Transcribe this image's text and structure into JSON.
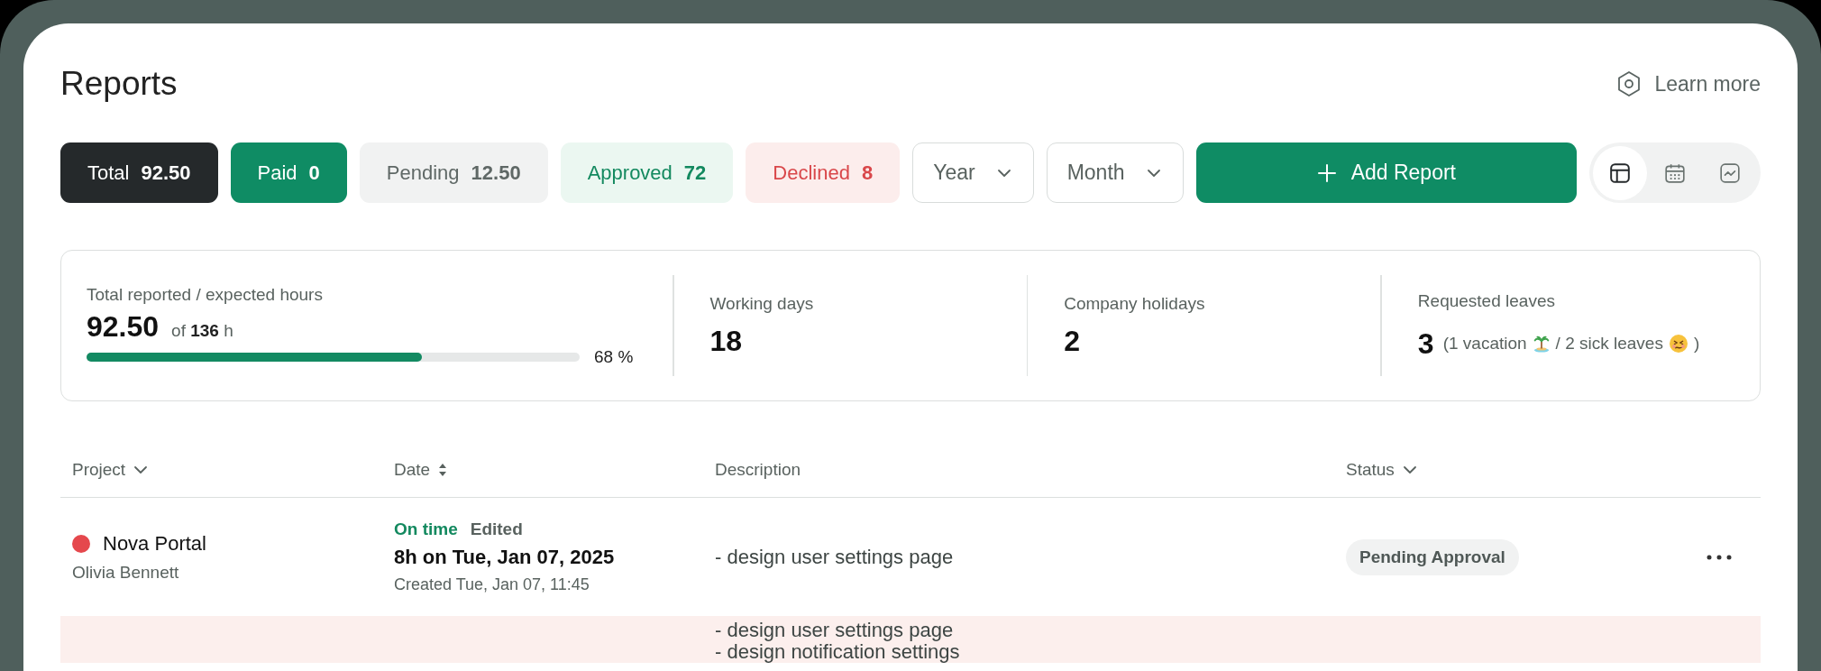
{
  "page_title": "Reports",
  "learn_more": "Learn more",
  "filters": [
    {
      "kind": "dark",
      "label": "Total",
      "count": "92.50"
    },
    {
      "kind": "green",
      "label": "Paid",
      "count": "0"
    },
    {
      "kind": "grey",
      "label": "Pending",
      "count": "12.50"
    },
    {
      "kind": "mint",
      "label": "Approved",
      "count": "72"
    },
    {
      "kind": "red",
      "label": "Declined",
      "count": "8"
    }
  ],
  "dropdowns": [
    {
      "label": "Year"
    },
    {
      "label": "Month"
    }
  ],
  "add_button": "Add Report",
  "views": [
    {
      "kind": "table",
      "selected": true
    },
    {
      "kind": "calendar",
      "selected": false
    },
    {
      "kind": "chart",
      "selected": false
    }
  ],
  "stats": {
    "hours": {
      "label": "Total reported / expected hours",
      "value": "92.50",
      "of_text": "of **136** h",
      "level": 0.68,
      "reading": "68 %"
    },
    "working_days": {
      "label": "Working days",
      "value": "18"
    },
    "holidays": {
      "label": "Company holidays",
      "value": "2"
    },
    "leaves": {
      "label": "Requested leaves",
      "value": "3",
      "note_open": "(1 vacation",
      "note_middle": "/ 2 sick leaves",
      "note_close": ")"
    }
  },
  "table": {
    "columns": [
      {
        "label": "Project",
        "kind": "dropdown"
      },
      {
        "label": "Date",
        "kind": "sortable"
      },
      {
        "label": "Description",
        "kind": "plain"
      },
      {
        "label": "Status",
        "kind": "dropdown"
      }
    ],
    "rows": [
      {
        "highlighted": false,
        "project": "Nova Portal",
        "color": "#e5484d",
        "person": "Olivia Bennett",
        "timing": "On time",
        "edit_note": "Edited",
        "date": "8h on Tue, Jan 07, 2025",
        "created": "Created Tue, Jan 07, 11:45",
        "description": [
          "- design user settings page"
        ],
        "status": "Pending Approval"
      },
      {
        "highlighted": true,
        "description": [
          "- design user settings page",
          "- design notification settings"
        ]
      }
    ]
  }
}
